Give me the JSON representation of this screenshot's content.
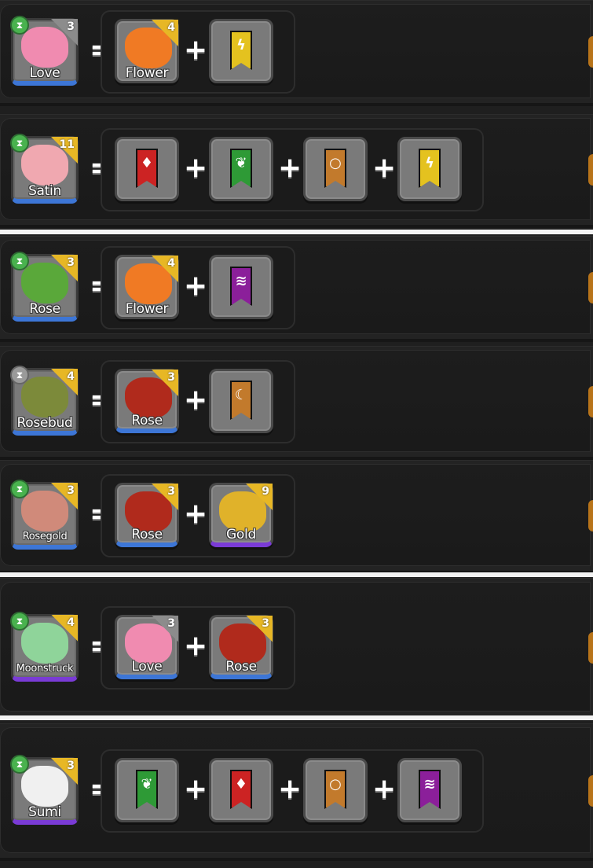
{
  "rows": [
    {
      "result": {
        "name": "Love",
        "level": "3",
        "timer": "green",
        "rarity": "blue",
        "corner": "gray",
        "color": "#f08bb0"
      },
      "ingredients": [
        {
          "kind": "creature",
          "name": "Flower",
          "level": "4",
          "corner": "gold",
          "color": "#f07a24"
        },
        {
          "kind": "banner",
          "element": "lightning",
          "color": "#e4c21f",
          "glyph": "ϟ"
        }
      ]
    },
    {
      "result": {
        "name": "Satin",
        "level": "11",
        "timer": "green",
        "rarity": "blue",
        "corner": "gold",
        "color": "#f0a8b0"
      },
      "ingredients": [
        {
          "kind": "banner",
          "element": "fire",
          "color": "#cc2323",
          "glyph": "♦"
        },
        {
          "kind": "banner",
          "element": "plant",
          "color": "#2e9a36",
          "glyph": "❦"
        },
        {
          "kind": "banner",
          "element": "earth",
          "color": "#c27a2c",
          "glyph": "○"
        },
        {
          "kind": "banner",
          "element": "lightning",
          "color": "#e4c21f",
          "glyph": "ϟ"
        }
      ]
    },
    {
      "result": {
        "name": "Rose",
        "level": "3",
        "timer": "green",
        "rarity": "blue",
        "corner": "gold",
        "color": "#5aa83a"
      },
      "ingredients": [
        {
          "kind": "creature",
          "name": "Flower",
          "level": "4",
          "corner": "gold",
          "color": "#f07a24"
        },
        {
          "kind": "banner",
          "element": "water",
          "color": "#8b1f9a",
          "glyph": "≋"
        }
      ]
    },
    {
      "result": {
        "name": "Rosebud",
        "level": "4",
        "timer": "gray",
        "rarity": "blue",
        "corner": "gold",
        "color": "#7c8a3a"
      },
      "ingredients": [
        {
          "kind": "creature",
          "name": "Rose",
          "level": "3",
          "corner": "gold",
          "color": "#b02a1c",
          "rarity": "blue"
        },
        {
          "kind": "banner",
          "element": "earth",
          "color": "#c27a2c",
          "glyph": "☾"
        }
      ]
    },
    {
      "result": {
        "name": "Rosegold",
        "level": "3",
        "timer": "green",
        "rarity": "blue",
        "corner": "gold",
        "color": "#d08a7a"
      },
      "ingredients": [
        {
          "kind": "creature",
          "name": "Rose",
          "level": "3",
          "corner": "gold",
          "color": "#b02a1c",
          "rarity": "blue"
        },
        {
          "kind": "creature",
          "name": "Gold",
          "level": "9",
          "corner": "gold",
          "color": "#e0b22a",
          "rarity": "purple"
        }
      ]
    },
    {
      "result": {
        "name": "Moonstruck",
        "level": "4",
        "timer": "green",
        "rarity": "purple",
        "corner": "gold",
        "color": "#8fd49a"
      },
      "ingredients": [
        {
          "kind": "creature",
          "name": "Love",
          "level": "3",
          "corner": "gray",
          "color": "#f08bb0",
          "rarity": "blue"
        },
        {
          "kind": "creature",
          "name": "Rose",
          "level": "3",
          "corner": "gold",
          "color": "#b02a1c",
          "rarity": "blue"
        }
      ]
    },
    {
      "result": {
        "name": "Sumi",
        "level": "3",
        "timer": "green",
        "rarity": "purple",
        "corner": "gold",
        "color": "#f0f0f0"
      },
      "ingredients": [
        {
          "kind": "banner",
          "element": "plant",
          "color": "#2e9a36",
          "glyph": "❦"
        },
        {
          "kind": "banner",
          "element": "fire",
          "color": "#cc2323",
          "glyph": "♦"
        },
        {
          "kind": "banner",
          "element": "earth",
          "color": "#c27a2c",
          "glyph": "○"
        },
        {
          "kind": "banner",
          "element": "water",
          "color": "#8b1f9a",
          "glyph": "≋"
        }
      ]
    }
  ],
  "symbols": {
    "equals": "=",
    "plus": "+"
  },
  "icons": {
    "timer": "hourglass-icon"
  }
}
